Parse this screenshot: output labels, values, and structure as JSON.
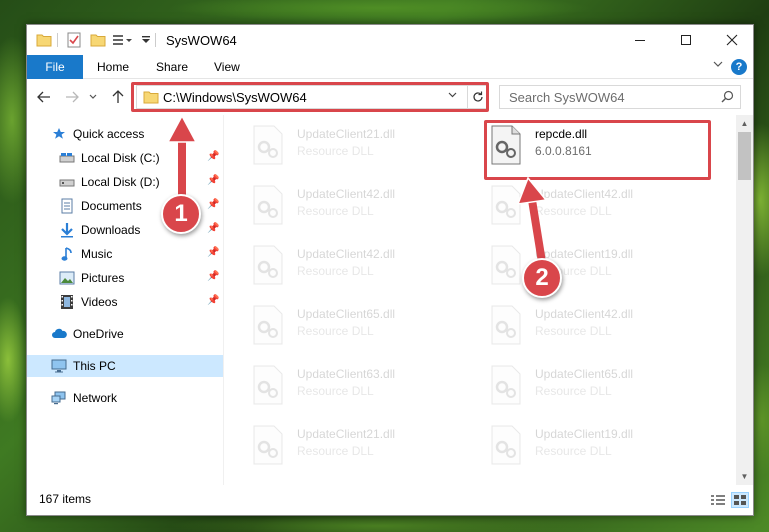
{
  "window": {
    "title": "SysWOW64"
  },
  "ribbon": {
    "tabs": [
      "File",
      "Home",
      "Share",
      "View"
    ],
    "help_label": "?"
  },
  "address": {
    "path": "C:\\Windows\\SysWOW64"
  },
  "search": {
    "placeholder": "Search SysWOW64"
  },
  "sidebar": {
    "items": [
      {
        "label": "Quick access",
        "icon": "star-icon"
      },
      {
        "label": "Local Disk (C:)",
        "icon": "drive-icon"
      },
      {
        "label": "Local Disk (D:)",
        "icon": "drive-icon"
      },
      {
        "label": "Documents",
        "icon": "documents-icon"
      },
      {
        "label": "Downloads",
        "icon": "download-arrow-icon"
      },
      {
        "label": "Music",
        "icon": "music-note-icon"
      },
      {
        "label": "Pictures",
        "icon": "pictures-icon"
      },
      {
        "label": "Videos",
        "icon": "film-icon"
      },
      {
        "label": "OneDrive",
        "icon": "cloud-icon"
      },
      {
        "label": "This PC",
        "icon": "monitor-icon"
      },
      {
        "label": "Network",
        "icon": "network-icon"
      }
    ],
    "selected": "This PC"
  },
  "files": {
    "left_column": [
      {
        "name": "UpdateClient21.dll",
        "type": "Resource DLL"
      },
      {
        "name": "UpdateClient42.dll",
        "type": "Resource DLL"
      },
      {
        "name": "UpdateClient42.dll",
        "type": "Resource DLL"
      },
      {
        "name": "UpdateClient65.dll",
        "type": "Resource DLL"
      },
      {
        "name": "UpdateClient63.dll",
        "type": "Resource DLL"
      },
      {
        "name": "UpdateClient21.dll",
        "type": "Resource DLL"
      }
    ],
    "right_column": [
      {
        "name": "repcde.dll",
        "type": "6.0.0.8161",
        "highlighted": true
      },
      {
        "name": "UpdateClient42.dll",
        "type": "Resource DLL"
      },
      {
        "name": "UpdateClient19.dll",
        "type": "Resource DLL"
      },
      {
        "name": "UpdateClient42.dll",
        "type": "Resource DLL"
      },
      {
        "name": "UpdateClient65.dll",
        "type": "Resource DLL"
      },
      {
        "name": "UpdateClient19.dll",
        "type": "Resource DLL"
      }
    ]
  },
  "status": {
    "item_count": "167 items"
  },
  "callouts": {
    "step1": "1",
    "step2": "2"
  },
  "colors": {
    "accent": "#1979ca",
    "highlight": "#d9464b",
    "selection": "#cce8ff"
  }
}
